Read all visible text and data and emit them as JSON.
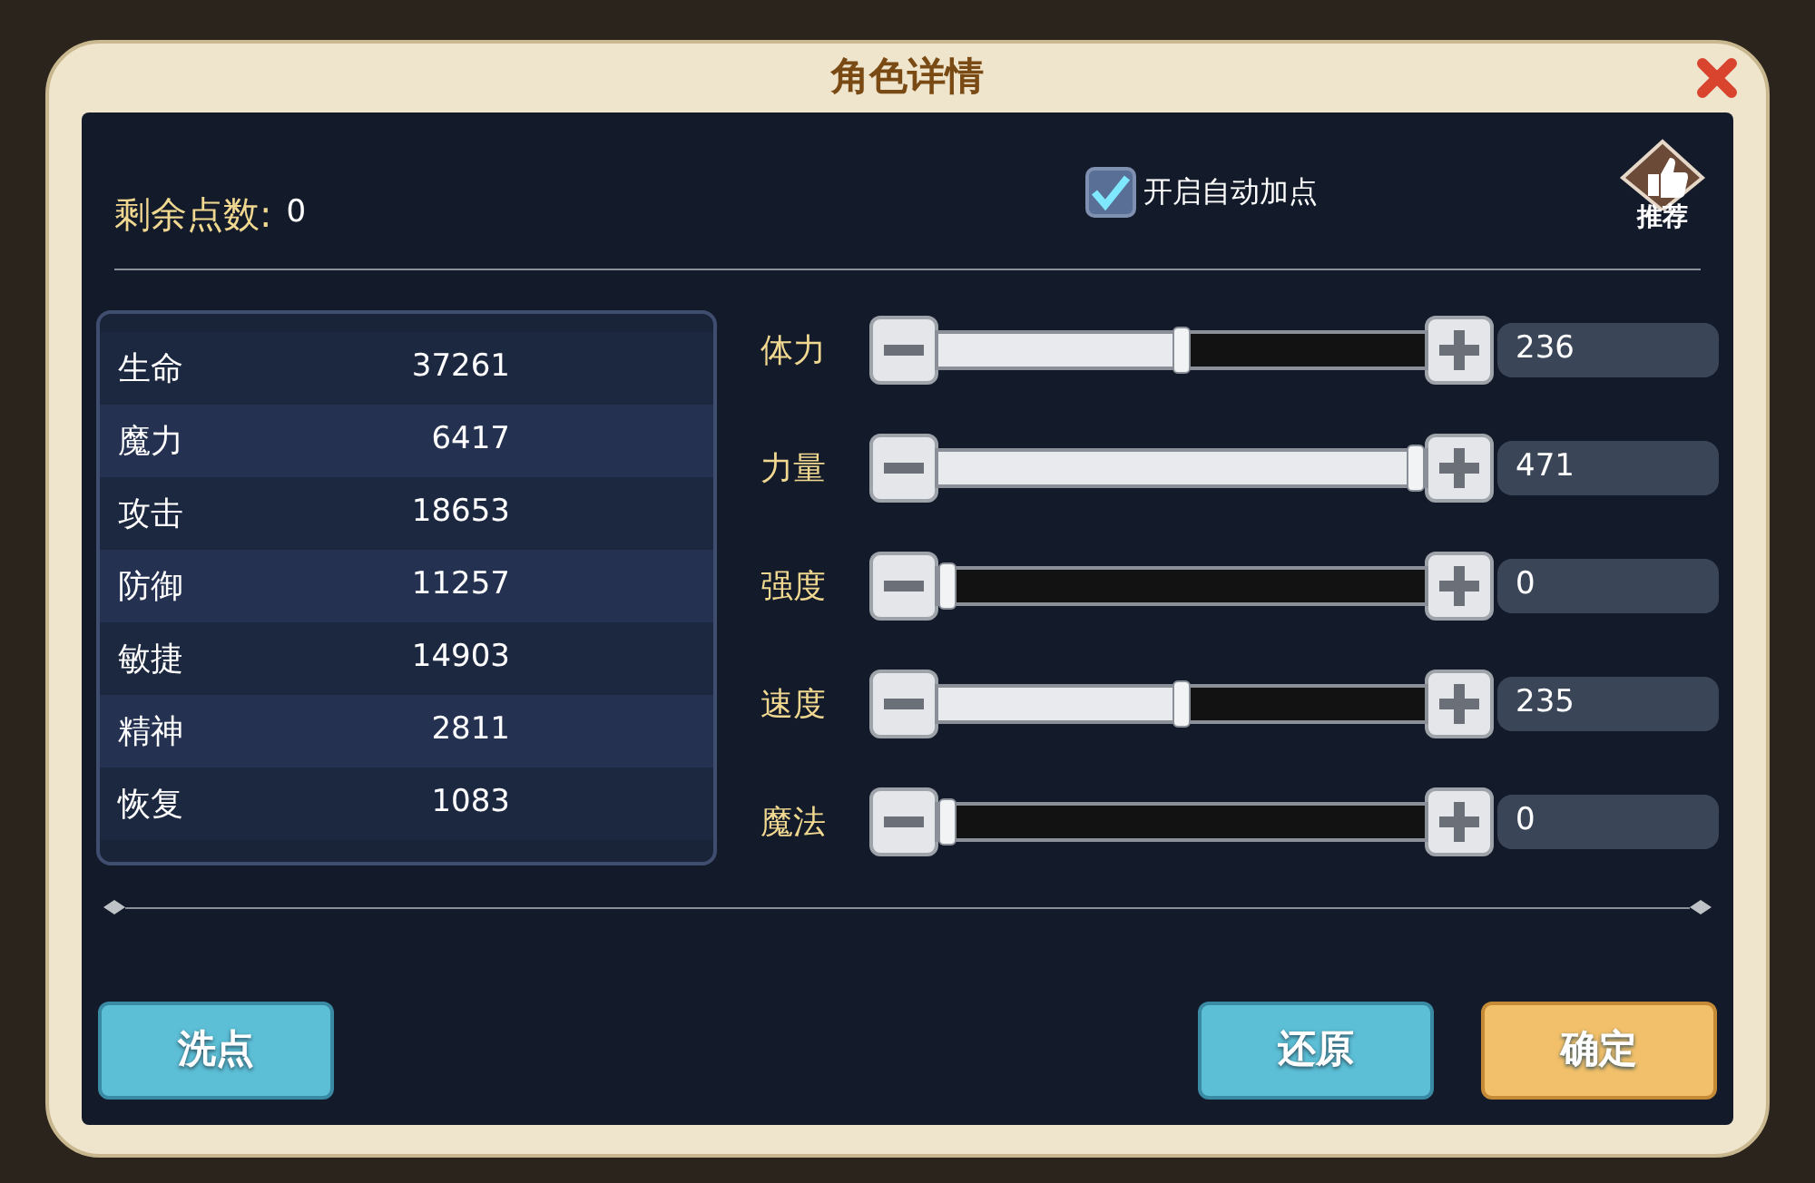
{
  "dialog": {
    "title": "角色详情"
  },
  "remaining_points": {
    "label": "剩余点数:",
    "value": "0"
  },
  "auto_allocate": {
    "label": "开启自动加点",
    "checked": true
  },
  "recommend": {
    "label": "推荐"
  },
  "stats": [
    {
      "name": "生命",
      "value": "37261"
    },
    {
      "name": "魔力",
      "value": "6417"
    },
    {
      "name": "攻击",
      "value": "18653"
    },
    {
      "name": "防御",
      "value": "11257"
    },
    {
      "name": "敏捷",
      "value": "14903"
    },
    {
      "name": "精神",
      "value": "2811"
    },
    {
      "name": "恢复",
      "value": "1083"
    }
  ],
  "attributes": [
    {
      "name": "体力",
      "level": 0.5,
      "value": "236"
    },
    {
      "name": "力量",
      "level": 1,
      "value": "471"
    },
    {
      "name": "强度",
      "level": 0,
      "value": "0"
    },
    {
      "name": "速度",
      "level": 0.5,
      "value": "235"
    },
    {
      "name": "魔法",
      "level": 0,
      "value": "0"
    }
  ],
  "buttons": [
    {
      "label": "洗点",
      "kind": "reset"
    },
    {
      "label": "还原",
      "kind": "restore"
    },
    {
      "label": "确定",
      "kind": "confirm"
    }
  ]
}
